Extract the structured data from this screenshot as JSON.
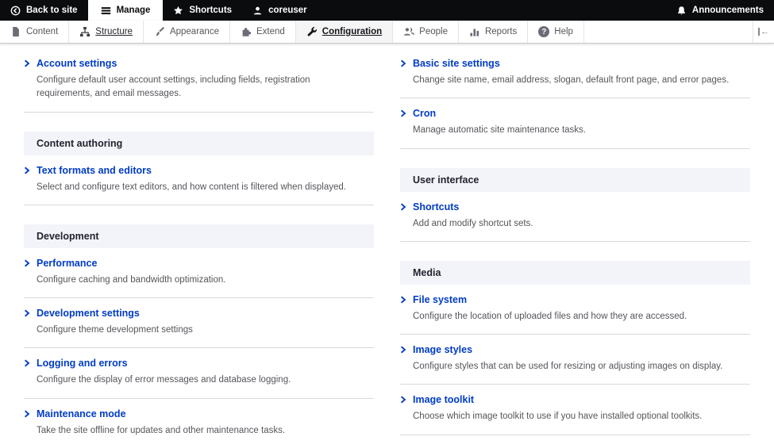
{
  "toolbar_top": {
    "items": [
      {
        "label": "Back to site",
        "icon": "back-arrow-icon"
      },
      {
        "label": "Manage",
        "icon": "hamburger-icon",
        "active": true
      },
      {
        "label": "Shortcuts",
        "icon": "star-icon"
      },
      {
        "label": "coreuser",
        "icon": "user-icon"
      }
    ],
    "announcements": {
      "label": "Announcements",
      "icon": "bell-icon"
    }
  },
  "admin_menu": {
    "tabs": [
      {
        "label": "Content",
        "icon": "file-icon"
      },
      {
        "label": "Structure",
        "icon": "sitemap-icon",
        "underlined": true
      },
      {
        "label": "Appearance",
        "icon": "paintbrush-icon"
      },
      {
        "label": "Extend",
        "icon": "puzzle-icon"
      },
      {
        "label": "Configuration",
        "icon": "wrench-icon",
        "active": true
      },
      {
        "label": "People",
        "icon": "people-icon"
      },
      {
        "label": "Reports",
        "icon": "bar-chart-icon"
      },
      {
        "label": "Help",
        "icon": "help-icon"
      }
    ],
    "toggle_icon": "toolbar-orientation-toggle-icon",
    "help_glyph": "?",
    "toggle_glyph": "←"
  },
  "main": {
    "left": [
      {
        "items": [
          {
            "title": "Account settings",
            "description": "Configure default user account settings, including fields, registration requirements, and email messages."
          }
        ]
      },
      {
        "header": "Content authoring",
        "items": [
          {
            "title": "Text formats and editors",
            "description": "Select and configure text editors, and how content is filtered when displayed."
          }
        ]
      },
      {
        "header": "Development",
        "items": [
          {
            "title": "Performance",
            "description": "Configure caching and bandwidth optimization."
          },
          {
            "title": "Development settings",
            "description": "Configure theme development settings"
          },
          {
            "title": "Logging and errors",
            "description": "Configure the display of error messages and database logging."
          },
          {
            "title": "Maintenance mode",
            "description": "Take the site offline for updates and other maintenance tasks."
          }
        ]
      }
    ],
    "right": [
      {
        "items": [
          {
            "title": "Basic site settings",
            "description": "Change site name, email address, slogan, default front page, and error pages."
          },
          {
            "title": "Cron",
            "description": "Manage automatic site maintenance tasks."
          }
        ]
      },
      {
        "header": "User interface",
        "items": [
          {
            "title": "Shortcuts",
            "description": "Add and modify shortcut sets."
          }
        ]
      },
      {
        "header": "Media",
        "items": [
          {
            "title": "File system",
            "description": "Configure the location of uploaded files and how they are accessed."
          },
          {
            "title": "Image styles",
            "description": "Configure styles that can be used for resizing or adjusting images on display."
          },
          {
            "title": "Image toolkit",
            "description": "Choose which image toolkit to use if you have installed optional toolkits."
          }
        ]
      }
    ]
  },
  "colors": {
    "link_blue": "#003cc5",
    "panel_header_bg": "#f3f4f9",
    "toolbar_black": "#0b0c0e",
    "tab_text": "#55565b",
    "description_text": "#55565b",
    "divider": "#d8d9de"
  }
}
